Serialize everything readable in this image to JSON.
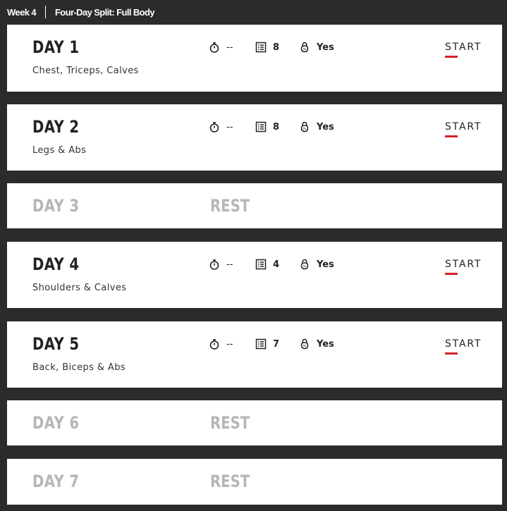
{
  "header": {
    "week_label": "Week 4",
    "program_label": "Four-Day Split: Full Body"
  },
  "days": [
    {
      "title": "DAY 1",
      "subtitle": "Chest, Triceps, Calves",
      "time": "--",
      "exercises": "8",
      "equipment": "Yes",
      "start_label": "START"
    },
    {
      "title": "DAY 2",
      "subtitle": "Legs & Abs",
      "time": "--",
      "exercises": "8",
      "equipment": "Yes",
      "start_label": "START"
    },
    {
      "title": "DAY 3",
      "rest_label": "REST"
    },
    {
      "title": "DAY 4",
      "subtitle": "Shoulders & Calves",
      "time": "--",
      "exercises": "4",
      "equipment": "Yes",
      "start_label": "START"
    },
    {
      "title": "DAY 5",
      "subtitle": "Back, Biceps & Abs",
      "time": "--",
      "exercises": "7",
      "equipment": "Yes",
      "start_label": "START"
    },
    {
      "title": "DAY 6",
      "rest_label": "REST"
    },
    {
      "title": "DAY 7",
      "rest_label": "REST"
    }
  ],
  "icons": {
    "time": "stopwatch-icon",
    "exercises": "checklist-icon",
    "equipment": "kettlebell-icon"
  },
  "colors": {
    "background": "#2b2b2b",
    "card": "#ffffff",
    "accent": "#d4202b",
    "rest_text": "#b6b6b6"
  }
}
